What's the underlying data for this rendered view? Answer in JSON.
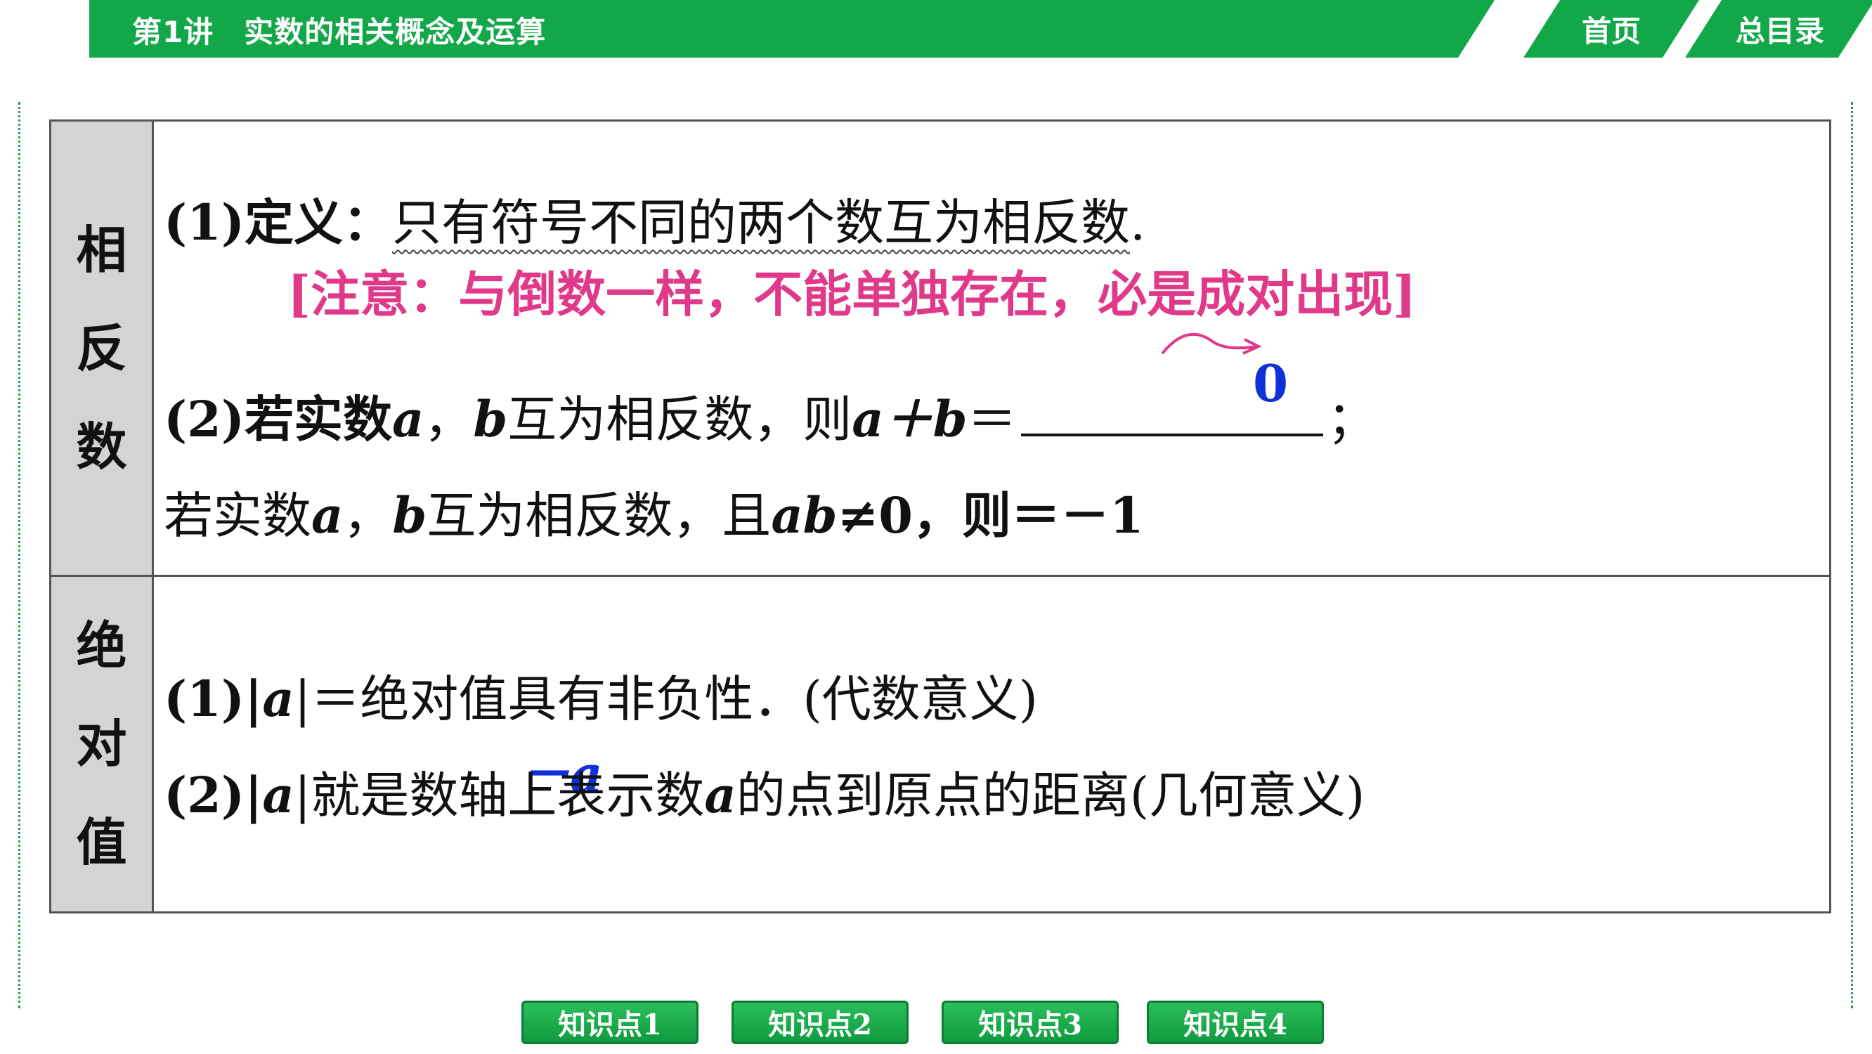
{
  "header": {
    "title": "第1讲　实数的相关概念及运算",
    "nav_home": "首页",
    "nav_toc": "总目录"
  },
  "section_opposite": {
    "label_chars": [
      "相",
      "反",
      "数"
    ],
    "def_prefix": "(1)定义：",
    "def_text": "只有符号不同的两个数互为相反数",
    "def_end": ".",
    "note": "[注意：与倒数一样，不能单独存在，必是成对出现]",
    "line2_prefix": "(2)若实数",
    "var_a": "a",
    "comma": "，",
    "var_b": "b",
    "line2_mid": "互为相反数，则",
    "sum_expr": "a＋b",
    "equals": "＝",
    "semicolon": "；",
    "answer_sum": "0",
    "line3_prefix": "若实数",
    "line3_mid": "互为相反数，且",
    "ab": "ab",
    "neq_zero": "≠0，则＝－1"
  },
  "section_abs": {
    "label_chars": [
      "绝",
      "对",
      "值"
    ],
    "line1_prefix": "(1)|",
    "line1_after": "|＝绝对值具有非负性．(代数意义)",
    "line2_prefix": "(2)|",
    "line2_after": "|就是数轴上表示数",
    "line2_end": "的点到原点的距离(几何意义)",
    "answer_neg_a": "－a"
  },
  "bottom_nav": {
    "buttons": [
      "知识点1",
      "知识点2",
      "知识点3",
      "知识点4"
    ]
  },
  "colors": {
    "brand_green": "#12a84a",
    "note_pink": "#e0398a",
    "answer_blue": "#1030d8"
  }
}
